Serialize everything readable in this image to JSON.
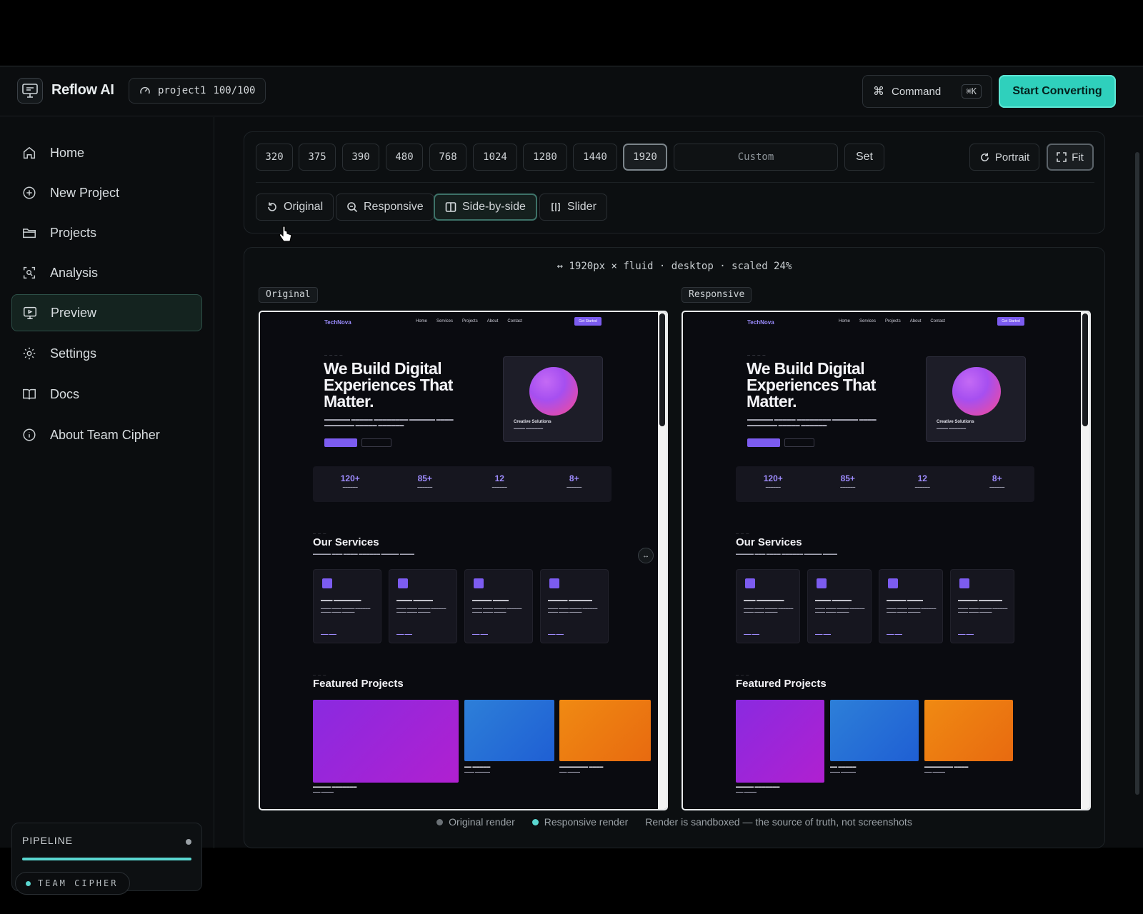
{
  "app": {
    "brand": "Reflow AI",
    "project_name": "project1",
    "project_score": "100/100"
  },
  "header": {
    "command_label": "Command",
    "command_shortcut": "⌘K",
    "start_label": "Start Converting"
  },
  "sidebar": {
    "items": [
      {
        "label": "Home",
        "icon": "home-icon"
      },
      {
        "label": "New Project",
        "icon": "plus-circle-icon"
      },
      {
        "label": "Projects",
        "icon": "folder-icon"
      },
      {
        "label": "Analysis",
        "icon": "scan-icon"
      },
      {
        "label": "Preview",
        "icon": "monitor-icon",
        "active": true
      },
      {
        "label": "Settings",
        "icon": "gear-icon"
      },
      {
        "label": "Docs",
        "icon": "book-icon"
      },
      {
        "label": "About Team Cipher",
        "icon": "info-icon"
      }
    ],
    "pipeline_label": "PIPELINE",
    "pipeline_progress": 1.0,
    "team_label": "TEAM CIPHER"
  },
  "toolbar": {
    "viewports": [
      "320",
      "375",
      "390",
      "480",
      "768",
      "1024",
      "1280",
      "1440",
      "1920"
    ],
    "active_viewport": "1920",
    "custom_placeholder": "Custom",
    "set_label": "Set",
    "portrait_label": "Portrait",
    "fit_label": "Fit",
    "modes": [
      "Original",
      "Responsive",
      "Side-by-side",
      "Slider"
    ],
    "active_mode": "Side-by-side"
  },
  "canvas": {
    "scale_info": "↔ 1920px × fluid · desktop · scaled 24%",
    "original_tag": "Original",
    "responsive_tag": "Responsive",
    "legend": {
      "original": "Original render",
      "responsive": "Responsive render",
      "note": "Render is sandboxed — the source of truth, not screenshots"
    }
  },
  "preview_site": {
    "logo": "TechNova",
    "nav_links": [
      "Home",
      "Services",
      "Projects",
      "About",
      "Contact"
    ],
    "nav_cta": "Get Started",
    "hero_title": "We Build Digital Experiences That Matter.",
    "card_title": "Creative Solutions",
    "stats": [
      {
        "value": "120+"
      },
      {
        "value": "85+"
      },
      {
        "value": "12"
      },
      {
        "value": "8+"
      }
    ],
    "services_title": "Our Services",
    "featured_title": "Featured Projects"
  },
  "colors": {
    "accent": "#2fd0bc",
    "site_purple": "#7c5cf0"
  }
}
